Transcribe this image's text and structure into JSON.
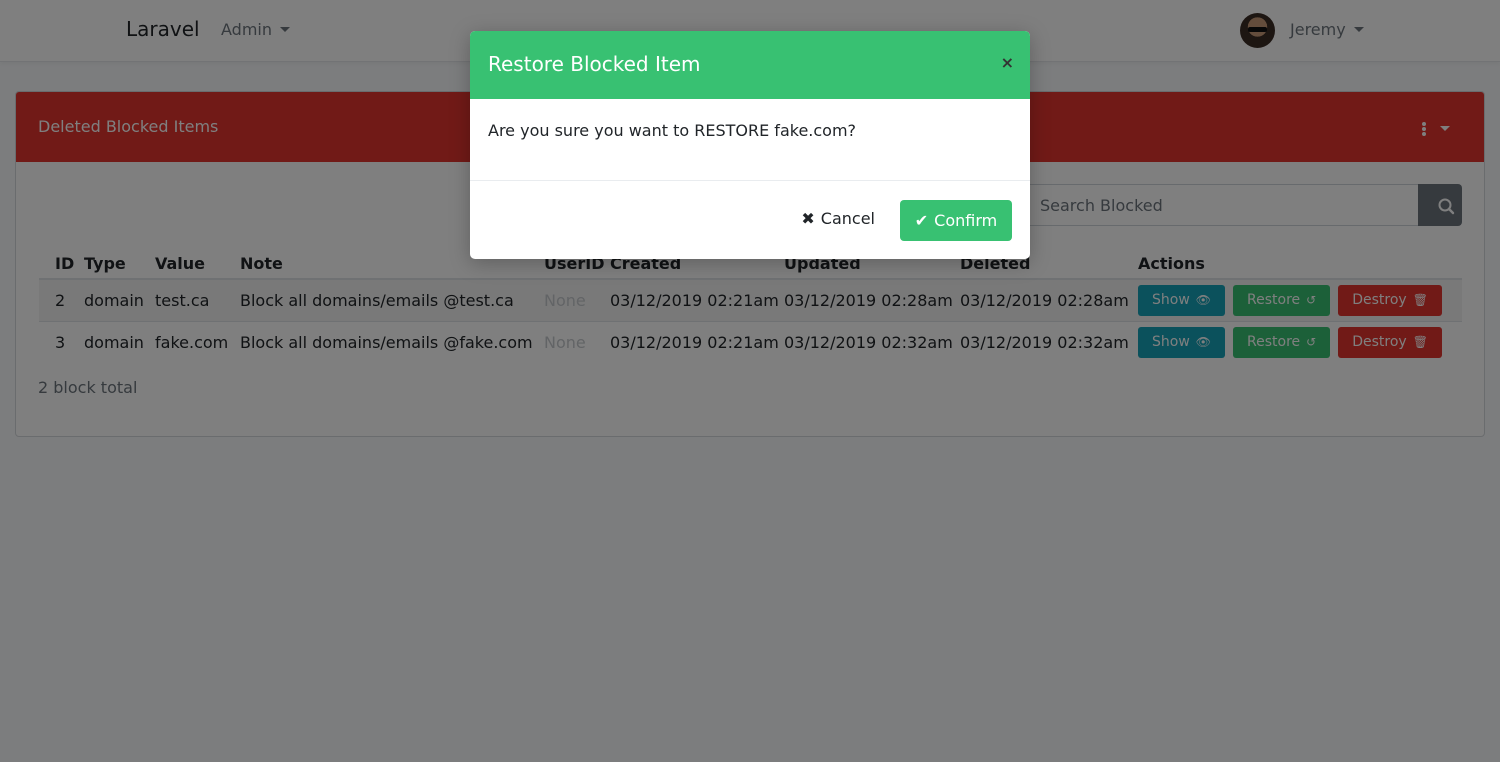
{
  "navbar": {
    "brand": "Laravel",
    "admin_label": "Admin",
    "user_name": "Jeremy"
  },
  "card": {
    "title": "Deleted Blocked Items",
    "search_placeholder": "Search Blocked",
    "columns": [
      "ID",
      "Type",
      "Value",
      "Note",
      "UserID",
      "Created",
      "Updated",
      "Deleted",
      "Actions"
    ],
    "rows": [
      {
        "id": "2",
        "type": "domain",
        "value": "test.ca",
        "note": "Block all domains/emails @test.ca",
        "user_id": "None",
        "created": "03/12/2019 02:21am",
        "updated": "03/12/2019 02:28am",
        "deleted": "03/12/2019 02:28am"
      },
      {
        "id": "3",
        "type": "domain",
        "value": "fake.com",
        "note": "Block all domains/emails @fake.com",
        "user_id": "None",
        "created": "03/12/2019 02:21am",
        "updated": "03/12/2019 02:32am",
        "deleted": "03/12/2019 02:32am"
      }
    ],
    "actions": {
      "show": "Show",
      "restore": "Restore",
      "destroy": "Destroy"
    },
    "total": "2 block total"
  },
  "modal": {
    "title": "Restore Blocked Item",
    "close": "×",
    "message": "Are you sure you want to RESTORE fake.com?",
    "cancel_label": "Cancel",
    "confirm_label": "Confirm"
  },
  "icons": {
    "caret": "caret-down-icon",
    "search": "search-icon",
    "show": "eye-icon",
    "restore": "history-icon",
    "destroy": "trash-icon",
    "cancel": "times-icon",
    "confirm": "check-icon"
  },
  "colors": {
    "header_red": "#e3342f",
    "modal_green": "#38c172",
    "show_blue": "#17a2b8",
    "secondary": "#6c757d"
  }
}
